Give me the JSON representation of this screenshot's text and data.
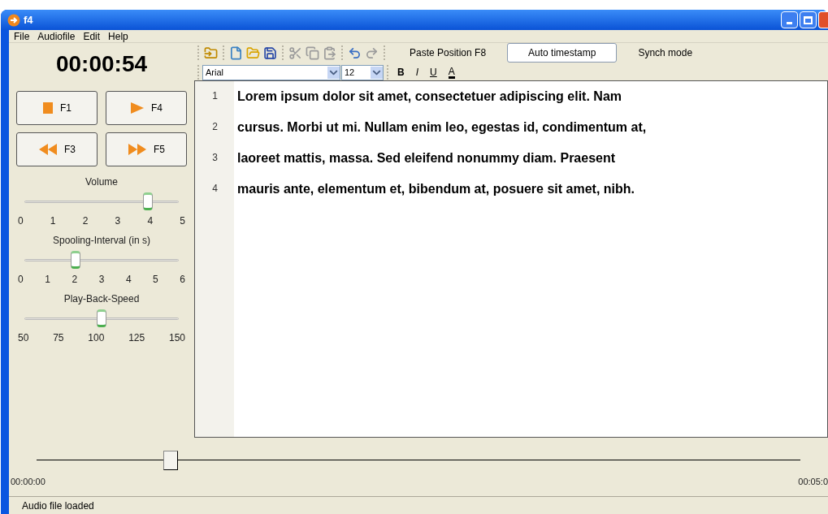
{
  "window": {
    "title": "f4"
  },
  "menu": [
    "File",
    "Audiofile",
    "Edit",
    "Help"
  ],
  "clock": "00:00:54",
  "transport": [
    {
      "kind": "stop",
      "label": "F1"
    },
    {
      "kind": "play",
      "label": "F4"
    },
    {
      "kind": "rewind",
      "label": "F3"
    },
    {
      "kind": "forward",
      "label": "F5"
    }
  ],
  "sliders": [
    {
      "label": "Volume",
      "level": 0.8,
      "ticks": [
        "0",
        "1",
        "2",
        "3",
        "4",
        "5"
      ]
    },
    {
      "label": "Spooling-Interval (in s)",
      "level": 0.333,
      "ticks": [
        "0",
        "1",
        "2",
        "3",
        "4",
        "5",
        "6"
      ]
    },
    {
      "label": "Play-Back-Speed",
      "level": 0.5,
      "ticks": [
        "50",
        "75",
        "100",
        "125",
        "150"
      ]
    }
  ],
  "toolbar": [
    {
      "kind": "import",
      "disabled": false
    },
    {
      "kind": "new",
      "disabled": false
    },
    {
      "kind": "open",
      "disabled": false
    },
    {
      "kind": "save",
      "disabled": false
    },
    {
      "kind": "cut",
      "disabled": true
    },
    {
      "kind": "copy",
      "disabled": true
    },
    {
      "kind": "paste",
      "disabled": true
    },
    {
      "kind": "undo",
      "disabled": false
    },
    {
      "kind": "redo",
      "disabled": true
    }
  ],
  "mode_buttons": [
    {
      "label": "Paste Position F8",
      "selected": false
    },
    {
      "label": "Auto timestamp",
      "selected": true
    },
    {
      "label": "Synch mode",
      "selected": false
    }
  ],
  "format": {
    "font": "Arial",
    "size": "12",
    "buttons": [
      {
        "kind": "bold",
        "label": "B"
      },
      {
        "kind": "italic",
        "label": "I"
      },
      {
        "kind": "underline",
        "label": "U"
      },
      {
        "kind": "color",
        "label": "A"
      }
    ]
  },
  "editor": {
    "lines": [
      {
        "number": "1",
        "text": "Lorem ipsum dolor sit amet, consectetuer adipiscing elit. Nam"
      },
      {
        "number": "2",
        "text": "cursus. Morbi ut mi. Nullam enim leo, egestas id, condimentum at,"
      },
      {
        "number": "3",
        "text": "laoreet mattis, massa. Sed eleifend nonummy diam. Praesent"
      },
      {
        "number": "4",
        "text": "mauris ante, elementum et, bibendum at, posuere sit amet, nibh."
      }
    ]
  },
  "position": {
    "level": 0.175,
    "start": "00:00:00",
    "end": "00:05:0"
  },
  "status_bar": "Audio file loaded"
}
